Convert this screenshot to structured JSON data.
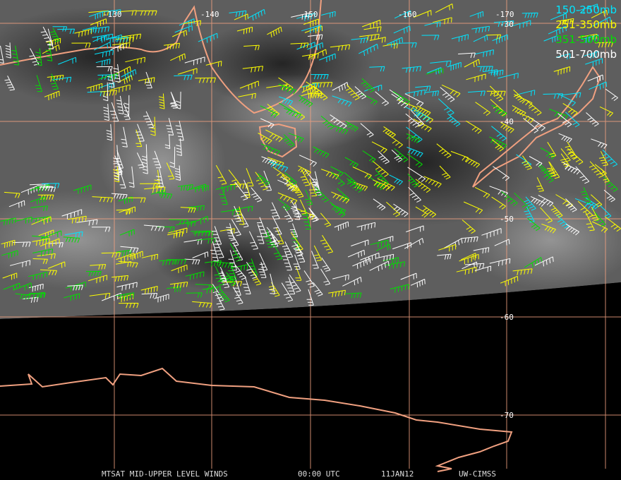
{
  "legend": [
    {
      "label": "150-250mb",
      "color": "#00e5ff"
    },
    {
      "label": "251-350mb",
      "color": "#ffff00"
    },
    {
      "label": "351-500mb",
      "color": "#00e000"
    },
    {
      "label": "501-700mb",
      "color": "#ffffff"
    }
  ],
  "longitude_labels": [
    "-130",
    "-140",
    "-150",
    "-160",
    "-170"
  ],
  "latitude_labels": [
    "-30",
    "-40",
    "-50",
    "-60",
    "-70"
  ],
  "footer": {
    "product": "MTSAT MID-UPPER LEVEL WINDS",
    "time": "00:00 UTC",
    "date": "11JAN12",
    "source": "UW-CIMSS"
  },
  "colors": {
    "grid": "#f0a080",
    "coastline": "#f0a080",
    "imagery_dark": "#2a2a2a",
    "imagery_light": "#8a8a8a",
    "night_area": "#000000"
  }
}
